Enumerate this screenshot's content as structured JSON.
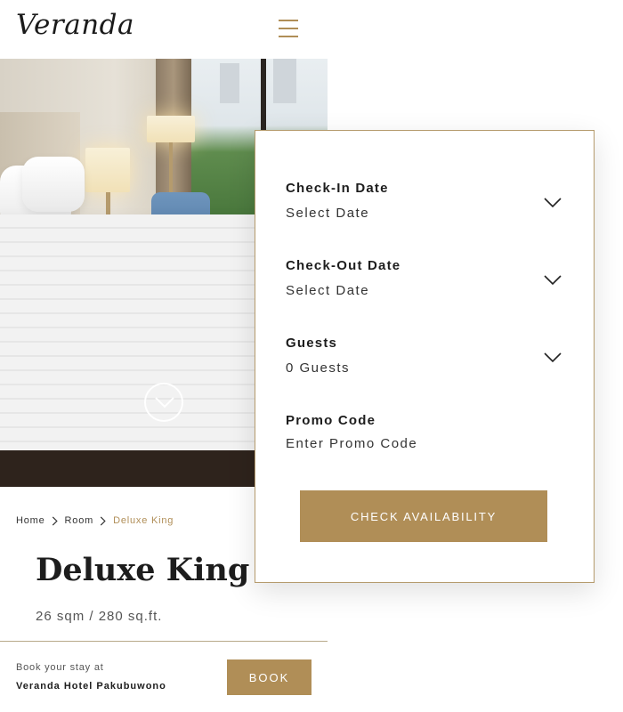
{
  "header": {
    "logo": "Veranda"
  },
  "hero": {
    "image_description": "hotel-room-bed"
  },
  "breadcrumb": {
    "home": "Home",
    "room": "Room",
    "current": "Deluxe King"
  },
  "room": {
    "title": "Deluxe King",
    "size": "26 sqm / 280 sq.ft."
  },
  "footer": {
    "book_label": "Book your stay at",
    "hotel_name": "Veranda Hotel Pakubuwono",
    "book_button": "BOOK"
  },
  "availability": {
    "checkin_label": "Check-In Date",
    "checkin_value": "Select Date",
    "checkout_label": "Check-Out Date",
    "checkout_value": "Select Date",
    "guests_label": "Guests",
    "guests_value": "0 Guests",
    "promo_label": "Promo Code",
    "promo_placeholder": "Enter Promo Code",
    "check_button": "CHECK AVAILABILITY"
  },
  "colors": {
    "accent": "#b08e57",
    "text": "#1d1d1d",
    "panel_border": "#b59b6d"
  }
}
